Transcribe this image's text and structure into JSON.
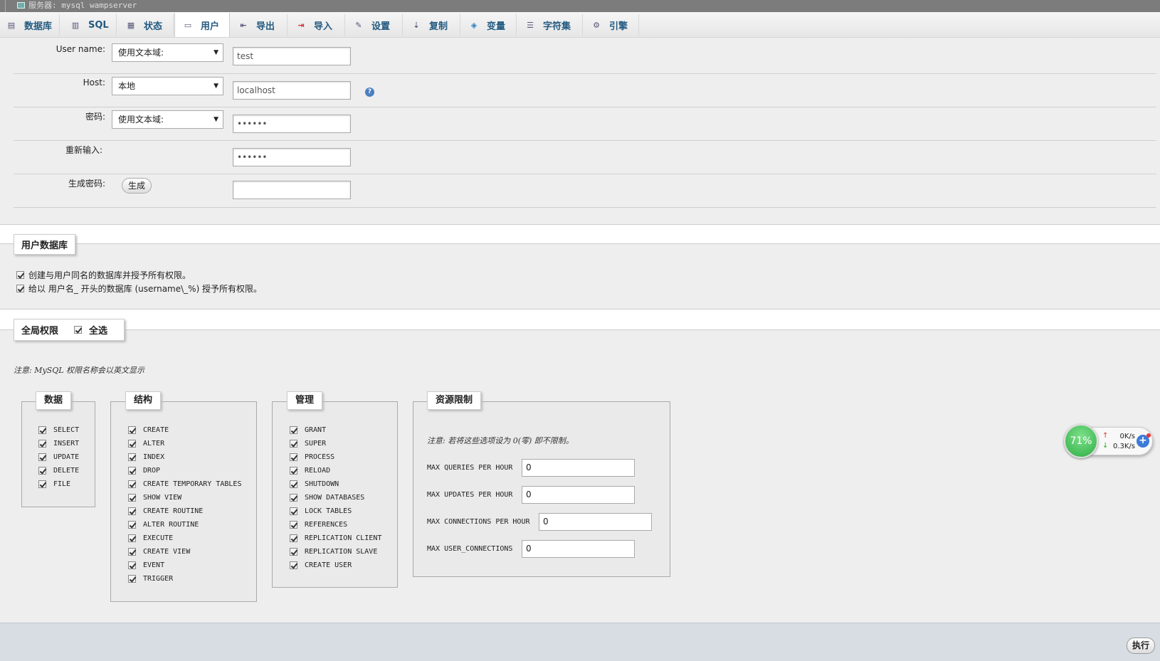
{
  "window": {
    "title": "服务器: mysql wampserver"
  },
  "tabs": [
    {
      "label": "数据库",
      "icon": "database-icon"
    },
    {
      "label": "SQL",
      "icon": "sql-icon"
    },
    {
      "label": "状态",
      "icon": "status-icon"
    },
    {
      "label": "用户",
      "icon": "users-icon",
      "active": true
    },
    {
      "label": "导出",
      "icon": "export-icon"
    },
    {
      "label": "导入",
      "icon": "import-icon"
    },
    {
      "label": "设置",
      "icon": "wrench-icon"
    },
    {
      "label": "复制",
      "icon": "replication-icon"
    },
    {
      "label": "变量",
      "icon": "variables-icon"
    },
    {
      "label": "字符集",
      "icon": "charset-icon"
    },
    {
      "label": "引擎",
      "icon": "engine-icon"
    }
  ],
  "login": {
    "username": {
      "label": "User name:",
      "select": "使用文本域:",
      "value": "test"
    },
    "host": {
      "label": "Host:",
      "select": "本地",
      "value": "localhost"
    },
    "password": {
      "label": "密码:",
      "select": "使用文本域:",
      "value": "••••••"
    },
    "retype": {
      "label": "重新输入:",
      "value": "••••••"
    },
    "generate": {
      "label": "生成密码:",
      "button": "生成",
      "value": ""
    }
  },
  "user_db": {
    "legend": "用户数据库",
    "options": [
      {
        "label": "创建与用户同名的数据库并授予所有权限。",
        "checked": true
      },
      {
        "label": "给以 用户名_ 开头的数据库 (username\\_%) 授予所有权限。",
        "checked": true
      }
    ]
  },
  "global": {
    "legend": "全局权限",
    "select_all": "全选",
    "note": "注意: MySQL 权限名称会以英文显示"
  },
  "groups": {
    "data": {
      "legend": "数据",
      "items": [
        "SELECT",
        "INSERT",
        "UPDATE",
        "DELETE",
        "FILE"
      ]
    },
    "structure": {
      "legend": "结构",
      "items": [
        "CREATE",
        "ALTER",
        "INDEX",
        "DROP",
        "CREATE TEMPORARY TABLES",
        "SHOW VIEW",
        "CREATE ROUTINE",
        "ALTER ROUTINE",
        "EXECUTE",
        "CREATE VIEW",
        "EVENT",
        "TRIGGER"
      ]
    },
    "admin": {
      "legend": "管理",
      "items": [
        "GRANT",
        "SUPER",
        "PROCESS",
        "RELOAD",
        "SHUTDOWN",
        "SHOW DATABASES",
        "LOCK TABLES",
        "REFERENCES",
        "REPLICATION CLIENT",
        "REPLICATION SLAVE",
        "CREATE USER"
      ]
    },
    "resource": {
      "legend": "资源限制",
      "note": "注意: 若将这些选项设为 0(零) 即不限制。",
      "limits": [
        {
          "label": "MAX QUERIES PER HOUR",
          "value": "0"
        },
        {
          "label": "MAX UPDATES PER HOUR",
          "value": "0"
        },
        {
          "label": "MAX CONNECTIONS PER HOUR",
          "value": "0"
        },
        {
          "label": "MAX USER_CONNECTIONS",
          "value": "0"
        }
      ]
    }
  },
  "footer": {
    "execute": "执行"
  },
  "widget": {
    "percent": "71%",
    "up": "0K/s",
    "down": "0.3K/s",
    "plus": "+"
  }
}
